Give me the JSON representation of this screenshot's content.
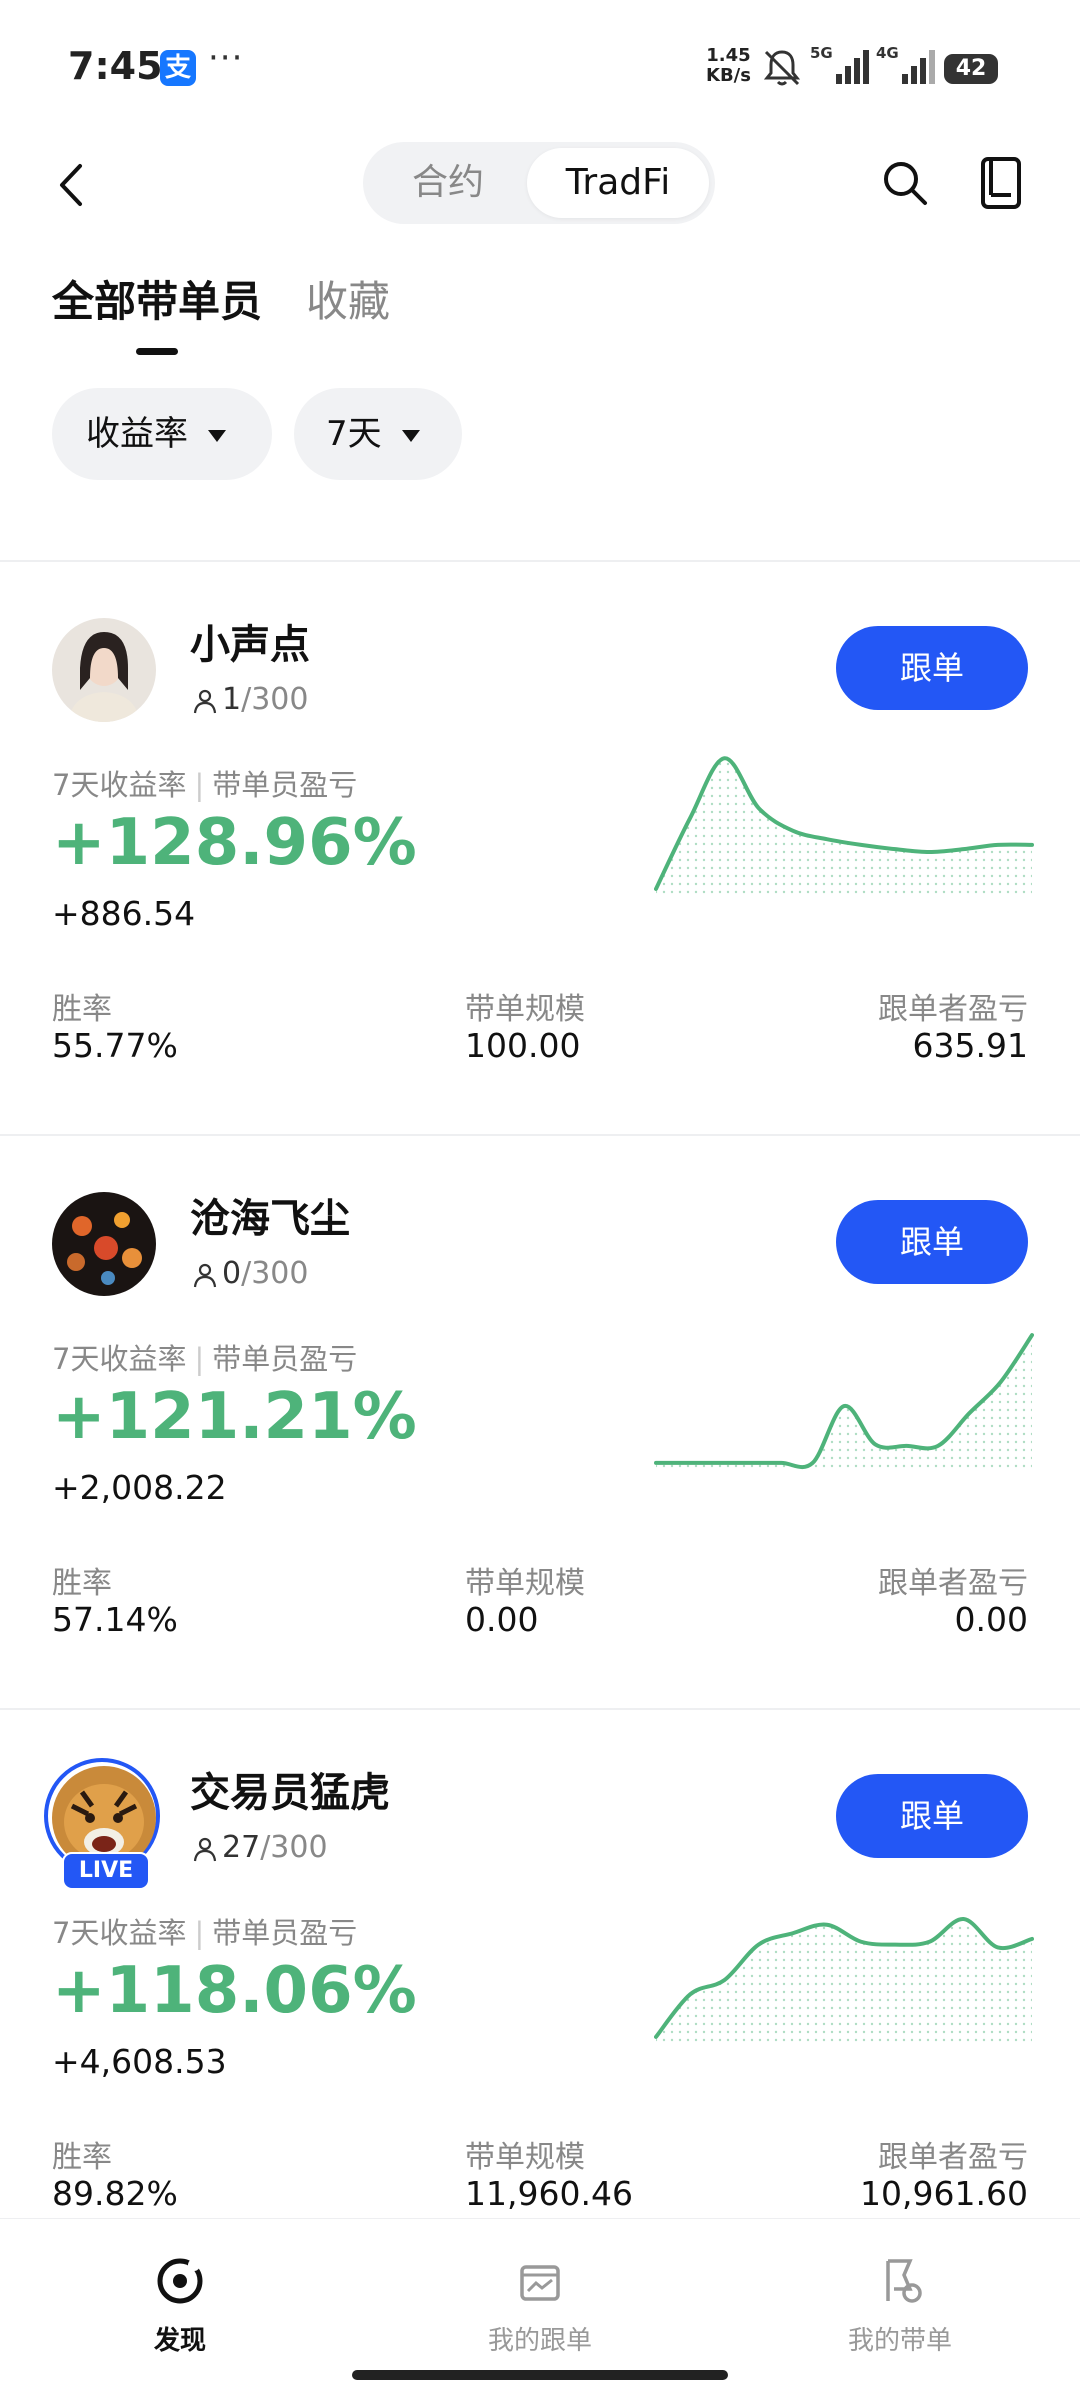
{
  "status_bar": {
    "time": "7:45",
    "app_badge": "支",
    "more": "···",
    "net_speed_top": "1.45",
    "net_speed_bottom": "KB/s",
    "sig1_label": "5G",
    "sig2_label": "4G",
    "battery": "42"
  },
  "header": {
    "segments": [
      "合约",
      "TradFi"
    ],
    "active_segment": "TradFi"
  },
  "tabs": {
    "all": "全部带单员",
    "favorites": "收藏"
  },
  "filters": {
    "sort": "收益率",
    "period": "7天"
  },
  "traders": [
    {
      "name": "小声点",
      "followers": "1",
      "followers_max": "/300",
      "button": "跟单",
      "roi_label": "7天收益率",
      "pnl_label": "带单员盈亏",
      "roi": "+128.96%",
      "pnl": "+886.54",
      "win_rate_label": "胜率",
      "win_rate": "55.77%",
      "scale_label": "带单规模",
      "scale": "100.00",
      "follower_pnl_label": "跟单者盈亏",
      "follower_pnl": "635.91",
      "live": false,
      "sparkline": [
        0.05,
        0.55,
        0.97,
        0.62,
        0.46,
        0.4,
        0.36,
        0.33,
        0.31,
        0.33,
        0.36,
        0.36
      ]
    },
    {
      "name": "沧海飞尘",
      "followers": "0",
      "followers_max": "/300",
      "button": "跟单",
      "roi_label": "7天收益率",
      "pnl_label": "带单员盈亏",
      "roi": "+121.21%",
      "pnl": "+2,008.22",
      "win_rate_label": "胜率",
      "win_rate": "57.14%",
      "scale_label": "带单规模",
      "scale": "0.00",
      "follower_pnl_label": "跟单者盈亏",
      "follower_pnl": "0.00",
      "live": false,
      "sparkline": [
        0.05,
        0.05,
        0.05,
        0.05,
        0.05,
        0.05,
        0.45,
        0.18,
        0.17,
        0.17,
        0.4,
        0.62,
        0.95
      ]
    },
    {
      "name": "交易员猛虎",
      "followers": "27",
      "followers_max": "/300",
      "button": "跟单",
      "live_label": "LIVE",
      "roi_label": "7天收益率",
      "pnl_label": "带单员盈亏",
      "roi": "+118.06%",
      "pnl": "+4,608.53",
      "win_rate_label": "胜率",
      "win_rate": "89.82%",
      "scale_label": "带单规模",
      "scale": "11,960.46",
      "follower_pnl_label": "跟单者盈亏",
      "follower_pnl": "10,961.60",
      "live": true,
      "sparkline": [
        0.05,
        0.35,
        0.45,
        0.7,
        0.78,
        0.84,
        0.72,
        0.7,
        0.72,
        0.88,
        0.68,
        0.74
      ]
    }
  ],
  "bottom_nav": [
    "发现",
    "我的跟单",
    "我的带单"
  ],
  "colors": {
    "accent": "#2357f5",
    "profit": "#4eb37a"
  }
}
